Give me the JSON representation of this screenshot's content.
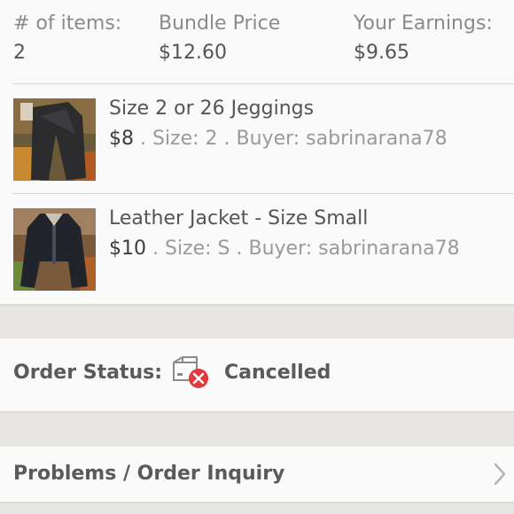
{
  "summary": {
    "items_label": "# of items:",
    "items_value": "2",
    "bundle_label": "Bundle Price",
    "bundle_value": "$12.60",
    "earnings_label": "Your Earnings:",
    "earnings_value": "$9.65"
  },
  "items": [
    {
      "title": "Size 2 or 26 Jeggings",
      "price": "$8",
      "details": " . Size: 2 . Buyer: sabrinarana78",
      "thumb_icon": "jeggings-photo"
    },
    {
      "title": "Leather Jacket - Size Small",
      "price": "$10",
      "details": " . Size: S . Buyer: sabrinarana78",
      "thumb_icon": "leather-jacket-photo"
    }
  ],
  "order_status": {
    "label": "Order Status:",
    "value": "Cancelled",
    "icon": "cancelled-package-icon",
    "icon_color": "#e0393e"
  },
  "inquiry": {
    "label": "Problems / Order Inquiry",
    "icon": "chevron-right-icon"
  }
}
